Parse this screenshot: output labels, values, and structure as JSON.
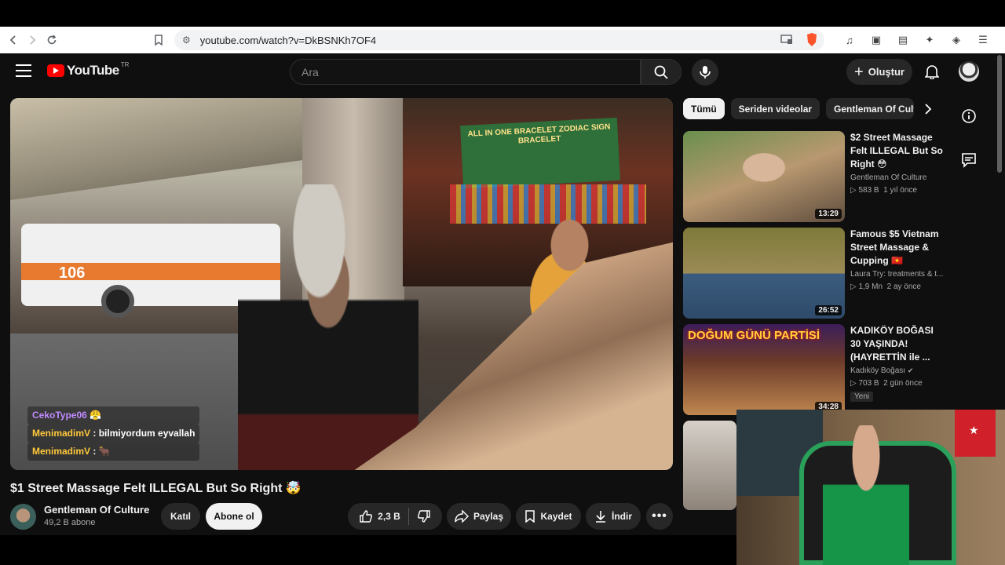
{
  "browser": {
    "url": "youtube.com/watch?v=DkBSNKh7OF4"
  },
  "masthead": {
    "logo_text": "YouTube",
    "region": "TR",
    "search_placeholder": "Ara",
    "create_label": "Oluştur"
  },
  "video": {
    "title": "$1 Street Massage Felt ILLEGAL But So Right 🤯",
    "channel": "Gentleman Of Culture",
    "subscribers": "49,2 B abone",
    "join_label": "Katıl",
    "subscribe_label": "Abone ol",
    "likes": "2,3 B",
    "share_label": "Paylaş",
    "save_label": "Kaydet",
    "download_label": "İndir",
    "chat": [
      {
        "name": "CekoType06",
        "msg": ""
      },
      {
        "name": "MenimadimV",
        "msg": ": bilmiyordum eyvallah"
      },
      {
        "name": "MenimadimV",
        "msg": ":"
      }
    ],
    "overlay_text": {
      "truck_number": "106",
      "sign": "ALL IN ONE BRACELET\nZODIAC SIGN BRACELET"
    }
  },
  "chips": [
    "Tümü",
    "Seriden videolar",
    "Gentleman Of Culture"
  ],
  "recommendations": [
    {
      "title": "$2 Street Massage Felt ILLEGAL But So Right 😳",
      "channel": "Gentleman Of Culture",
      "views": "583 B",
      "age": "1 yıl önce",
      "duration": "13:29"
    },
    {
      "title": "Famous $5 Vietnam Street Massage & Cupping 🇻🇳",
      "channel": "Laura Try: treatments & t...",
      "views": "1,9 Mn",
      "age": "2 ay önce",
      "duration": "26:52"
    },
    {
      "title": "KADIKÖY BOĞASI 30 YAŞINDA! (HAYRETTİN ile ...",
      "channel": "Kadıköy Boğası",
      "views": "703 B",
      "age": "2 gün önce",
      "duration": "34:28",
      "badge": "Yeni",
      "thumb_text": "DOĞUM GÜNÜ PARTİSİ"
    }
  ]
}
